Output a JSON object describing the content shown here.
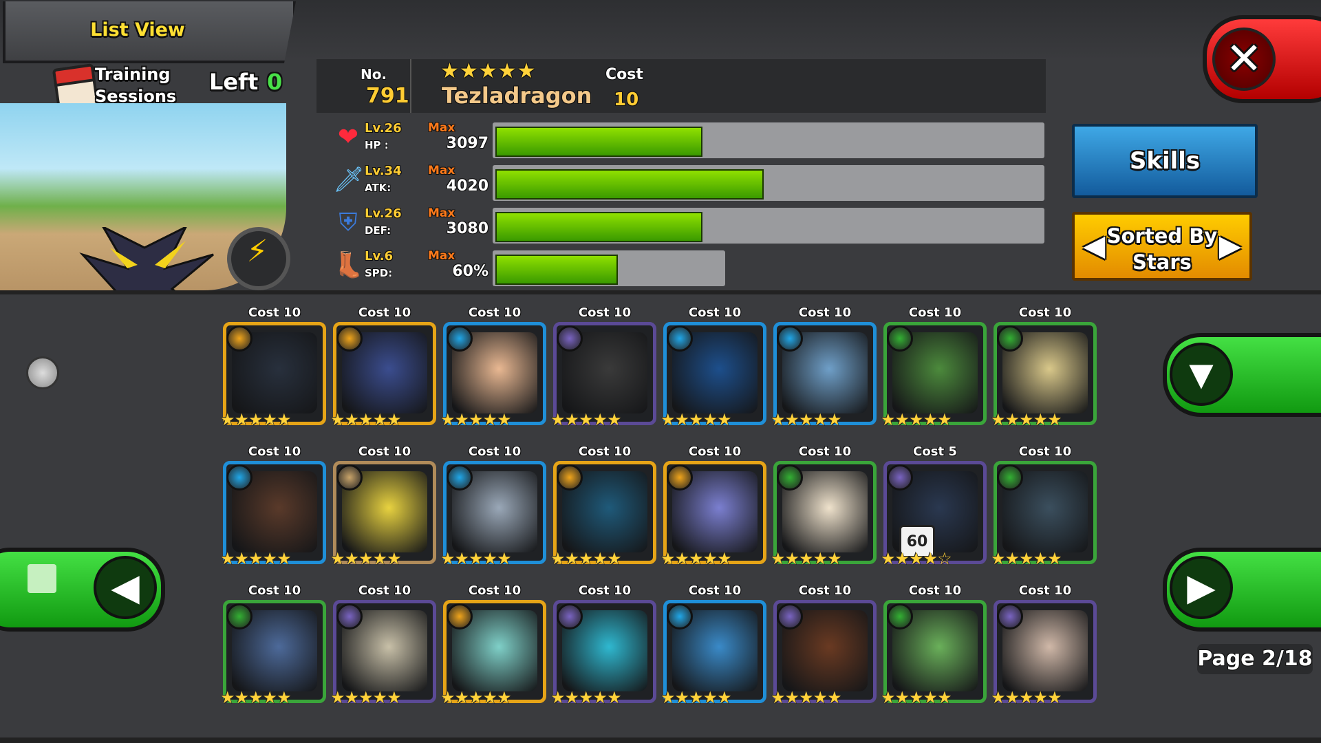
{
  "header": {
    "list_view_label": "List View",
    "close_icon": "close-icon"
  },
  "training": {
    "label": "Training\nSessions",
    "left_label": "Left",
    "left_value": "0"
  },
  "monster": {
    "no_label": "No.",
    "no_value": "791",
    "stars": "★★★★★",
    "name": "Tezladragon",
    "cost_label": "Cost",
    "cost_value": "10"
  },
  "stats": [
    {
      "icon": "heart-icon",
      "glyph": "❤",
      "color": "#ff2a3c",
      "lv": "Lv.26",
      "name": "HP :",
      "max": "Max",
      "value": "3097",
      "fill": 0.43
    },
    {
      "icon": "sword-icon",
      "glyph": "🗡",
      "color": "#6cc8ff",
      "lv": "Lv.34",
      "name": "ATK:",
      "max": "Max",
      "value": "4020",
      "fill": 0.56
    },
    {
      "icon": "shield-icon",
      "glyph": "⛨",
      "color": "#3b7bdc",
      "lv": "Lv.26",
      "name": "DEF:",
      "max": "Max",
      "value": "3080",
      "fill": 0.43
    },
    {
      "icon": "boot-icon",
      "glyph": "👢",
      "color": "#c97a2a",
      "lv": "Lv.6",
      "name": "SPD:",
      "max": "Max",
      "value": "60%",
      "fill": 0.6
    }
  ],
  "buttons": {
    "skills": "Skills",
    "sorted_line1": "Sorted By",
    "sorted_line2": "Stars"
  },
  "pagination": {
    "page_label": "Page 2/18"
  },
  "grid": [
    {
      "cost": "Cost 10",
      "stars": "★★★★★",
      "frame": "#e6a417",
      "element": "lightning",
      "elem_color": "#f0a51c",
      "art": "#28303d"
    },
    {
      "cost": "Cost 10",
      "stars": "★★★★★",
      "frame": "#e6a417",
      "element": "lightning",
      "elem_color": "#f0a51c",
      "art": "#3b4d8f"
    },
    {
      "cost": "Cost 10",
      "stars": "★★★★★",
      "frame": "#1f8fd8",
      "element": "water",
      "elem_color": "#21a7e8",
      "art": "#e9b892"
    },
    {
      "cost": "Cost 10",
      "stars": "★★★★★",
      "frame": "#5b4a96",
      "element": "dark",
      "elem_color": "#7a64c2",
      "art": "#3a3a3a"
    },
    {
      "cost": "Cost 10",
      "stars": "★★★★★",
      "frame": "#1f8fd8",
      "element": "water",
      "elem_color": "#21a7e8",
      "art": "#1d4f8c"
    },
    {
      "cost": "Cost 10",
      "stars": "★★★★★",
      "frame": "#1f8fd8",
      "element": "water",
      "elem_color": "#21a7e8",
      "art": "#6f9fc8"
    },
    {
      "cost": "Cost 10",
      "stars": "★★★★★",
      "frame": "#3aa53a",
      "element": "nature",
      "elem_color": "#33b033",
      "art": "#4c8a3c"
    },
    {
      "cost": "Cost 10",
      "stars": "★★★★★",
      "frame": "#3aa53a",
      "element": "nature",
      "elem_color": "#33b033",
      "art": "#d9c88a"
    },
    {
      "cost": "Cost 10",
      "stars": "★★★★★",
      "frame": "#1f8fd8",
      "element": "water",
      "elem_color": "#21a7e8",
      "art": "#5a3a2a"
    },
    {
      "cost": "Cost 10",
      "stars": "★★★★★",
      "frame": "#b08b5a",
      "element": "light",
      "elem_color": "#c9a46a",
      "art": "#e8d240"
    },
    {
      "cost": "Cost 10",
      "stars": "★★★★★",
      "frame": "#1f8fd8",
      "element": "water",
      "elem_color": "#21a7e8",
      "art": "#9aa8b8"
    },
    {
      "cost": "Cost 10",
      "stars": "★★★★★",
      "frame": "#e6a417",
      "element": "lightning",
      "elem_color": "#f0a51c",
      "art": "#1f5a7a"
    },
    {
      "cost": "Cost 10",
      "stars": "★★★★★",
      "frame": "#e6a417",
      "element": "lightning",
      "elem_color": "#f0a51c",
      "art": "#7b7fd0"
    },
    {
      "cost": "Cost 10",
      "stars": "★★★★★",
      "frame": "#3aa53a",
      "element": "nature",
      "elem_color": "#33b033",
      "art": "#efe2cc"
    },
    {
      "cost": "Cost 5",
      "stars": "★★★★☆",
      "frame": "#5b4a96",
      "element": "dark",
      "elem_color": "#7a64c2",
      "art": "#2a3850",
      "badge": "60"
    },
    {
      "cost": "Cost 10",
      "stars": "★★★★★",
      "frame": "#3aa53a",
      "element": "nature",
      "elem_color": "#33b033",
      "art": "#3b4f5e"
    },
    {
      "cost": "Cost 10",
      "stars": "★★★★★",
      "frame": "#3aa53a",
      "element": "nature",
      "elem_color": "#33b033",
      "art": "#4d6a9a"
    },
    {
      "cost": "Cost 10",
      "stars": "★★★★★",
      "frame": "#5b4a96",
      "element": "dark",
      "elem_color": "#7a64c2",
      "art": "#c8c0a8"
    },
    {
      "cost": "Cost 10",
      "stars": "★★★★★",
      "frame": "#e6a417",
      "element": "lightning",
      "elem_color": "#f0a51c",
      "art": "#7fd0c8"
    },
    {
      "cost": "Cost 10",
      "stars": "★★★★★",
      "frame": "#5b4a96",
      "element": "dark",
      "elem_color": "#7a64c2",
      "art": "#2fb8d0"
    },
    {
      "cost": "Cost 10",
      "stars": "★★★★★",
      "frame": "#1f8fd8",
      "element": "water",
      "elem_color": "#21a7e8",
      "art": "#3a8ac8"
    },
    {
      "cost": "Cost 10",
      "stars": "★★★★★",
      "frame": "#5b4a96",
      "element": "dark",
      "elem_color": "#7a64c2",
      "art": "#6a3a22"
    },
    {
      "cost": "Cost 10",
      "stars": "★★★★★",
      "frame": "#3aa53a",
      "element": "nature",
      "elem_color": "#33b033",
      "art": "#6ab05a"
    },
    {
      "cost": "Cost 10",
      "stars": "★★★★★",
      "frame": "#5b4a96",
      "element": "dark",
      "elem_color": "#7a64c2",
      "art": "#d0b8a8"
    }
  ]
}
